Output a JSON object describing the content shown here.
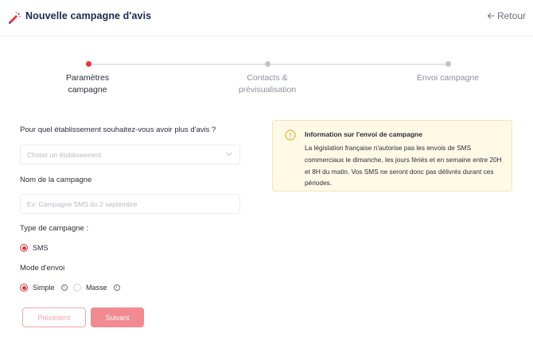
{
  "header": {
    "title": "Nouvelle campagne d'avis",
    "back_label": "Retour"
  },
  "stepper": {
    "steps": [
      {
        "label_line1": "Paramètres",
        "label_line2": "campagne",
        "active": true
      },
      {
        "label_line1": "Contacts &",
        "label_line2": "prévisualisation",
        "active": false
      },
      {
        "label_line1": "Envoi campagne",
        "label_line2": "",
        "active": false
      }
    ]
  },
  "form": {
    "establishment_question": "Pour quel établissement souhaitez-vous avoir plus d'avis ?",
    "establishment_placeholder": "Choisir un établissement",
    "campaign_name_label": "Nom de la campagne",
    "campaign_name_placeholder": "Ex: Campagne SMS du 2 septembre",
    "campaign_type_label": "Type de campagne :",
    "campaign_type_option": "SMS",
    "send_mode_label": "Mode d'envoi",
    "send_mode_simple": "Simple",
    "send_mode_mass": "Masse"
  },
  "buttons": {
    "previous": "Précédent",
    "next": "Suivant"
  },
  "alert": {
    "title": "Information sur l'envoi de campagne",
    "text": "La législation française n'autorise pas les envois de SMS commerciaux le dimanche, les jours fériés et en semaine entre 20H et 8H du matin. Vos SMS ne seront donc pas délivrés durant ces périodes."
  },
  "icons": {
    "logo": "megaphone-logo-icon",
    "back": "arrow-left-icon",
    "chevron": "chevron-down-icon",
    "alert": "warning-circle-icon",
    "info": "info-icon"
  },
  "colors": {
    "accent": "#e8323e",
    "button_next": "#f18b91",
    "button_prev_border": "#f4a4a9",
    "alert_bg": "#fff9e6",
    "title": "#1e2749"
  }
}
